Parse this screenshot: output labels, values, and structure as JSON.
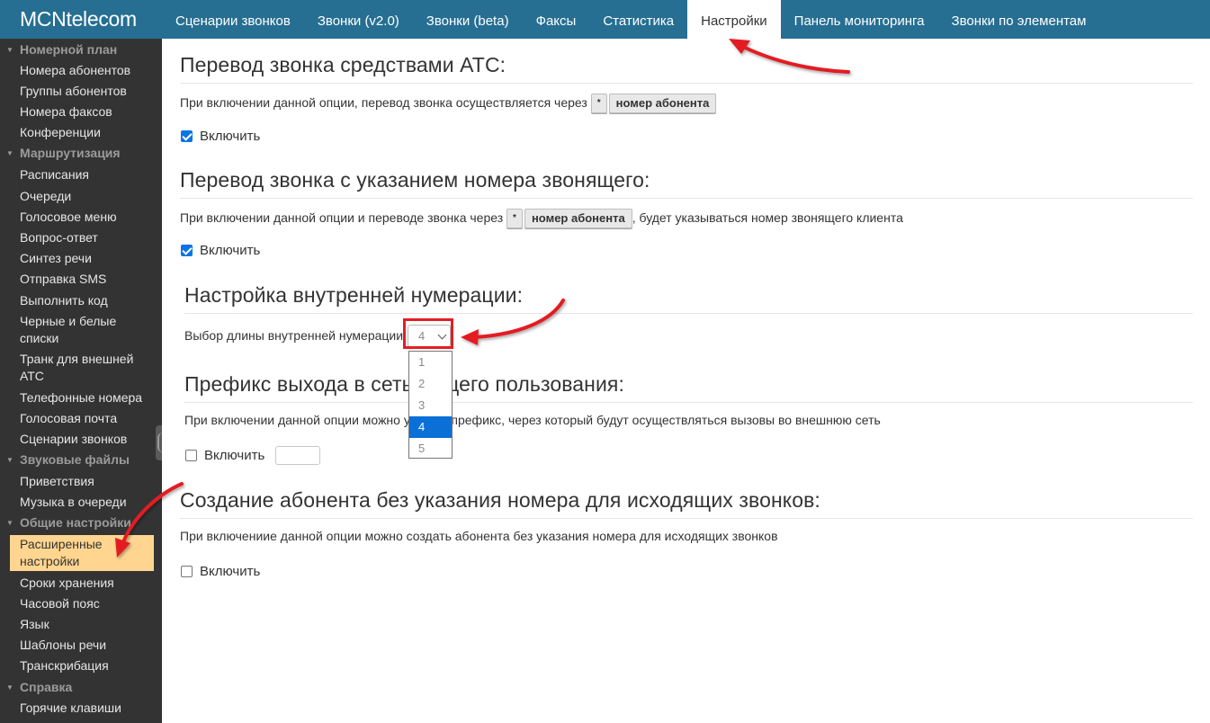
{
  "brand": "MCNtelecom",
  "nav": {
    "tabs": [
      {
        "label": "Сценарии звонков"
      },
      {
        "label": "Звонки (v2.0)"
      },
      {
        "label": "Звонки (beta)"
      },
      {
        "label": "Факсы"
      },
      {
        "label": "Статистика"
      },
      {
        "label": "Настройки"
      },
      {
        "label": "Панель мониторинга"
      },
      {
        "label": "Звонки по элементам"
      }
    ],
    "active_tab": "Настройки"
  },
  "sidebar": {
    "sections": [
      {
        "label": "Номерной план",
        "items": [
          "Номера абонентов",
          "Группы абонентов",
          "Номера факсов",
          "Конференции"
        ]
      },
      {
        "label": "Маршрутизация",
        "items": [
          "Расписания",
          "Очереди",
          "Голосовое меню",
          "Вопрос-ответ",
          "Синтез речи",
          "Отправка SMS",
          "Выполнить код",
          "Черные и белые списки",
          "Транк для внешней АТС",
          "Телефонные номера",
          "Голосовая почта",
          "Сценарии звонков"
        ]
      },
      {
        "label": "Звуковые файлы",
        "items": [
          "Приветствия",
          "Музыка в очереди"
        ]
      },
      {
        "label": "Общие настройки",
        "items": [
          "Расширенные настройки",
          "Сроки хранения",
          "Часовой пояс",
          "Язык",
          "Шаблоны речи",
          "Транскрибация"
        ]
      },
      {
        "label": "Справка",
        "items": [
          "Горячие клавиши"
        ]
      }
    ],
    "active_item": "Расширенные настройки"
  },
  "main": {
    "transfer_ats": {
      "title": "Перевод звонка средствами АТС:",
      "description": "При включении данной опции, перевод звонка осуществляется через",
      "key_star": "*",
      "key_number": "номер абонента",
      "checkbox_label": "Включить",
      "checked": true
    },
    "transfer_caller": {
      "title": "Перевод звонка с указанием номера звонящего:",
      "description_before": "При включении данной опции и переводе звонка через",
      "key_star": "*",
      "key_number": "номер абонента",
      "description_after": ", будет указываться номер звонящего клиента",
      "checkbox_label": "Включить",
      "checked": true
    },
    "internal_numbering": {
      "title": "Настройка внутренней нумерации:",
      "label": "Выбор длины внутренней нумерации",
      "selected_value": "4",
      "options": [
        "1",
        "2",
        "3",
        "4",
        "5"
      ]
    },
    "public_prefix": {
      "title": "Префикс выхода в сеть общего пользования:",
      "description": "При включении данной опции можно указать префикс, через который будут осуществляться вызовы во внешнюю сеть",
      "checkbox_label": "Включить",
      "checked": false,
      "prefix_value": ""
    },
    "subscriber_without_number": {
      "title": "Создание абонента без указания номера для исходящих звонков:",
      "description": "При включениие данной опции можно создать абонента без указания номера для исходящих звонков",
      "checkbox_label": "Включить",
      "checked": false
    }
  },
  "colors": {
    "navbar": "#266f92",
    "sidebar": "#333333",
    "active_sidebar_item": "#ffd58f",
    "annotation_red": "#e31e24",
    "dropdown_selected": "#0b6fd8"
  },
  "icons": {
    "section_caret": "caret-down-icon",
    "select_chevron": "chevron-down-icon",
    "annotation": "red-arrow"
  }
}
